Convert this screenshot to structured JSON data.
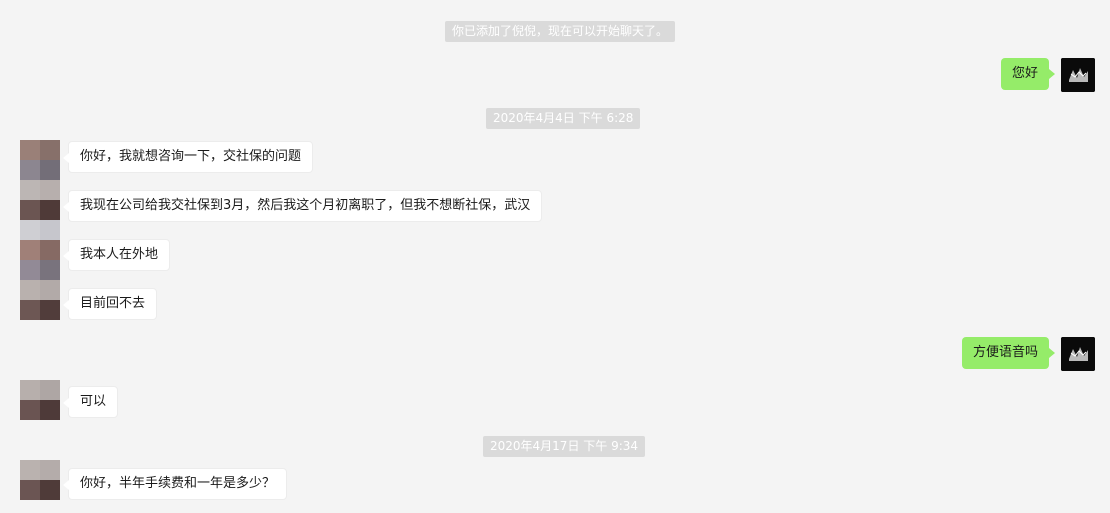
{
  "system_notices": {
    "added_friend": "你已添加了倪倪，现在可以开始聊天了。",
    "time_1": "2020年4月4日 下午 6:28",
    "time_2": "2020年4月17日 下午 9:34"
  },
  "messages": {
    "m1": {
      "sender": "me",
      "text": "您好"
    },
    "m2": {
      "sender": "contact",
      "text": "你好，我就想咨询一下，交社保的问题"
    },
    "m3": {
      "sender": "contact",
      "text": "我现在公司给我交社保到3月，然后我这个月初离职了，但我不想断社保，武汉"
    },
    "m4": {
      "sender": "contact",
      "text": "我本人在外地"
    },
    "m5": {
      "sender": "contact",
      "text": "目前回不去"
    },
    "m6": {
      "sender": "me",
      "text": "方便语音吗"
    },
    "m7": {
      "sender": "contact",
      "text": "可以"
    },
    "m8": {
      "sender": "contact",
      "text": "你好，半年手续费和一年是多少？"
    }
  },
  "colors": {
    "background": "#f4f4f4",
    "outgoing_bubble": "#95ec69",
    "incoming_bubble": "#ffffff",
    "system_notice": "#dadada"
  }
}
